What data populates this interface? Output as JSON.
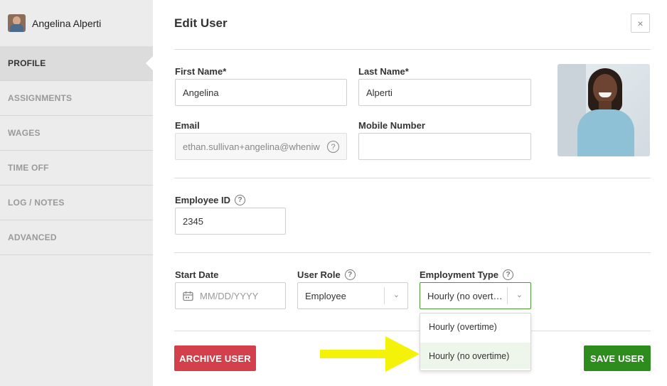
{
  "sidebar": {
    "user_name": "Angelina Alperti",
    "items": [
      {
        "label": "PROFILE",
        "active": true
      },
      {
        "label": "ASSIGNMENTS",
        "active": false
      },
      {
        "label": "WAGES",
        "active": false
      },
      {
        "label": "TIME OFF",
        "active": false
      },
      {
        "label": "LOG / NOTES",
        "active": false
      },
      {
        "label": "ADVANCED",
        "active": false
      }
    ]
  },
  "header": {
    "title": "Edit User",
    "close_icon": "×"
  },
  "form": {
    "first_name": {
      "label": "First Name*",
      "value": "Angelina"
    },
    "last_name": {
      "label": "Last Name*",
      "value": "Alperti"
    },
    "email": {
      "label": "Email",
      "value": "ethan.sullivan+angelina@wheniw"
    },
    "mobile": {
      "label": "Mobile Number",
      "value": ""
    },
    "employee_id": {
      "label": "Employee ID",
      "value": "2345"
    },
    "start_date": {
      "label": "Start Date",
      "placeholder": "MM/DD/YYYY"
    },
    "user_role": {
      "label": "User Role",
      "value": "Employee"
    },
    "employment_type": {
      "label": "Employment Type",
      "value": "Hourly (no overt…",
      "options": [
        "Hourly (overtime)",
        "Hourly (no overtime)"
      ],
      "highlighted": "Hourly (no overtime)"
    },
    "help_glyph": "?"
  },
  "buttons": {
    "archive": "ARCHIVE USER",
    "save": "SAVE USER"
  },
  "colors": {
    "archive": "#d3404c",
    "save": "#2e8b1e",
    "sidebar_bg": "#ececec",
    "highlight_arrow": "#f5f20a"
  },
  "icons": {
    "chevron": "⌄",
    "calendar": "calendar-icon"
  }
}
